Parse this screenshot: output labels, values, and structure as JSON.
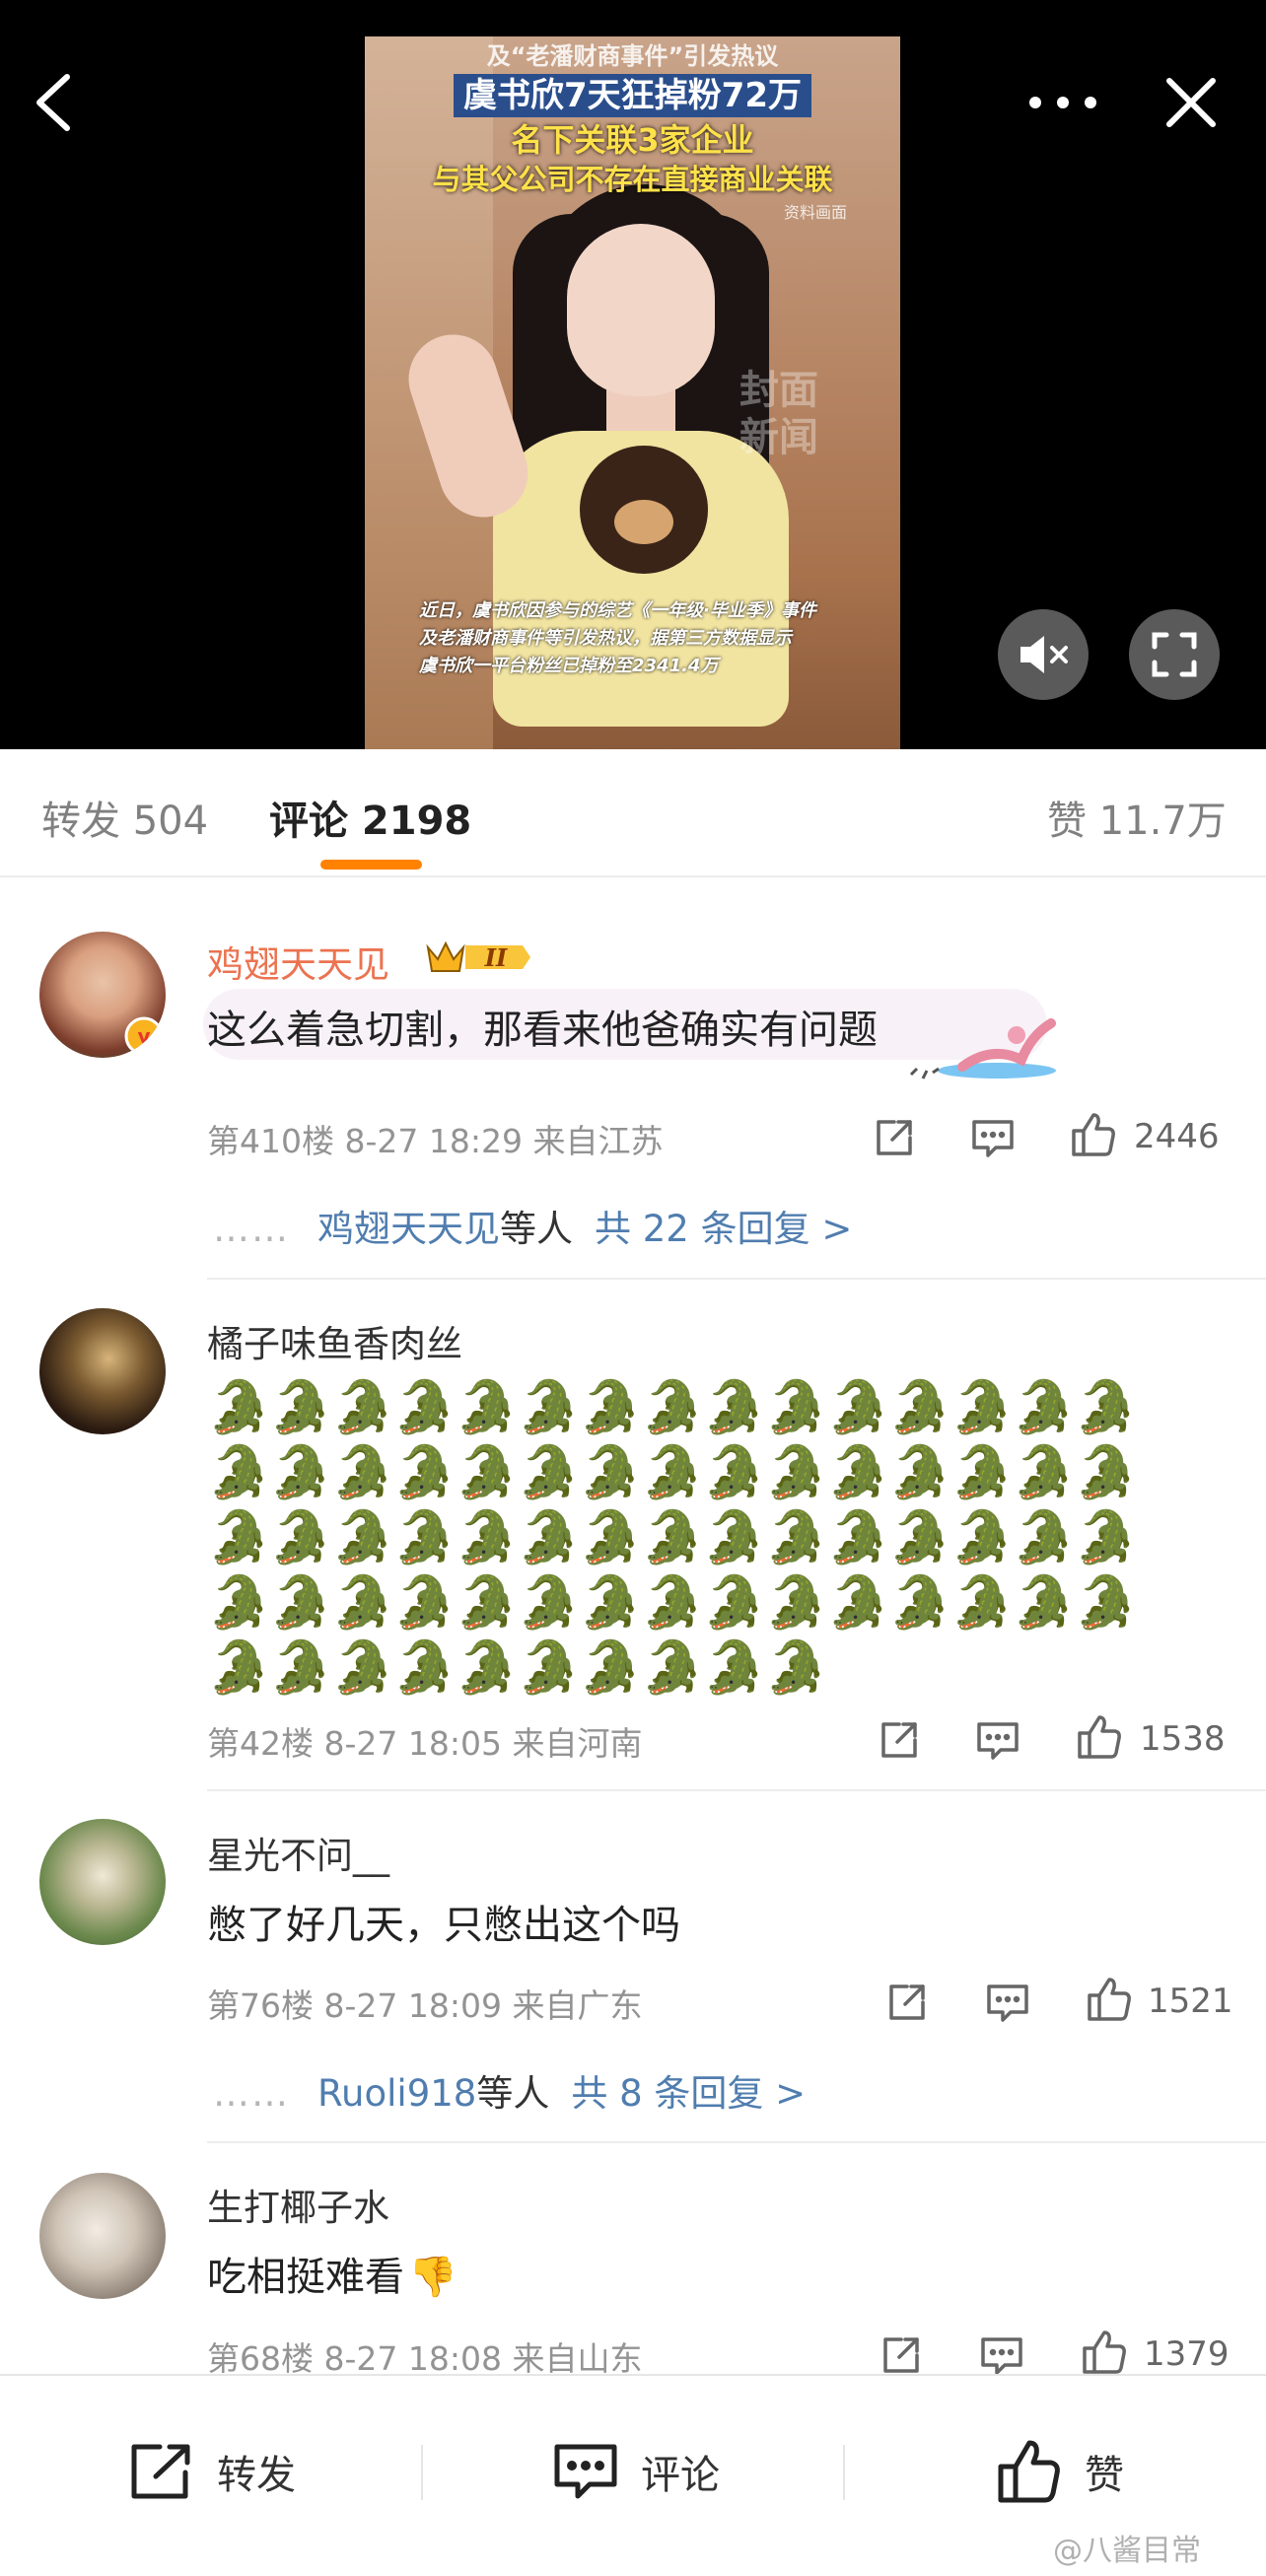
{
  "video": {
    "headline_top": "及“老潘财商事件”引发热议",
    "headline_1": "虞书欣7天狂掉粉72万",
    "headline_2": "名下关联3家企业",
    "headline_3": "与其父公司不存在直接商业关联",
    "credit": "资料画面",
    "watermark": "封面新闻",
    "caption_1": "近日，虞书欣因参与的综艺《一年级·毕业季》事件",
    "caption_2": "及老潘财商事件等引发热议，据第三方数据显示",
    "caption_3": "虞书欣一平台粉丝已掉粉至2341.4万"
  },
  "tabs": {
    "repost": "转发 504",
    "comment": "评论 2198",
    "like": "赞 11.7万",
    "active_color": "#ff8200"
  },
  "comments": [
    {
      "username": "鸡翅天天见",
      "badge": "II",
      "text": "这么着急切割，那看来他爸确实有问题",
      "meta": "第410楼 8-27 18:29 来自江苏",
      "likes": "2446",
      "reply_dots": "……",
      "reply_user": "鸡翅天天见",
      "reply_mid": "等人",
      "reply_count": "共 22 条回复 >"
    },
    {
      "username": "橘子味鱼香肉丝",
      "text_emoji": "🐊",
      "emoji_count": 70,
      "meta": "第42楼 8-27 18:05 来自河南",
      "likes": "1538"
    },
    {
      "username": "星光不问__",
      "text": "憋了好几天，只憋出这个吗",
      "meta": "第76楼 8-27 18:09 来自广东",
      "likes": "1521",
      "reply_dots": "……",
      "reply_user": "Ruoli918",
      "reply_mid": "等人",
      "reply_count": "共 8 条回复 >"
    },
    {
      "username": "生打椰子水",
      "text": "吃相挺难看",
      "text_emoji": "👎",
      "meta": "第68楼 8-27 18:08 来自山东",
      "likes": "1379"
    }
  ],
  "bottom_bar": {
    "repost": "转发",
    "comment": "评论",
    "like": "赞"
  },
  "watermark": "@八酱目常",
  "colors": {
    "link_blue": "#507daf",
    "vip_orange": "#eb7350",
    "meta_gray": "#939393"
  }
}
